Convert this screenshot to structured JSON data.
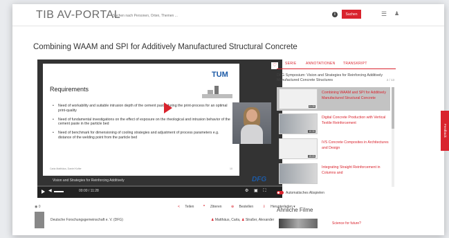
{
  "header": {
    "logo": "TIB AV-PORTAL",
    "search_placeholder": "Suchen nach Personen, Orten, Themen ...",
    "search_button": "Suchen"
  },
  "video": {
    "title": "Combining WAAM and SPI for Additively Manufactured Structural Concrete",
    "slide_title": "Requirements",
    "slide_logo": "TUM",
    "bullets": [
      "Need of workability and suitable intrusion depth of the cement paste during the print-process for an optimal print-quality",
      "Need of fundamental investigations on the effect of exposure on the rheological and intrusion behavior of the cement paste in the particle bed",
      "Need of benchmark for dimensioning of cooling strategies and adjustment of process parameters e.g. distance of the welding point from the particle bed"
    ],
    "slide_footer": "Carla Matthäus, Daniel Kofler",
    "slide_number": "10",
    "caption": "Vision and Strategies for Reinforcing Additively",
    "overlay_logo": "DFG",
    "time": "00:00 / 11:28",
    "progress": 0.0
  },
  "meta": {
    "views": "0",
    "share": "Teilen",
    "cite": "Zitieren",
    "order": "Bestellen",
    "download": "Herunterladen"
  },
  "publisher": {
    "name": "Deutsche Forschungsgemeinschaft e. V. (DFG)",
    "author1": "Matthäus, Carla",
    "author2": "Straßer, Alexander"
  },
  "sidebar": {
    "tabs": [
      "SERIE",
      "ANNOTATIONEN",
      "TRANSKRIPT"
    ],
    "series_title": "DFG Symposium: Vision and Strategies for Reinforcing Additively Manufactured Concrete Structures",
    "series_count": "2 / 13",
    "items": [
      {
        "title": "Combining WAAM and SPI for Additively Manufactured Structural Concrete",
        "duration": "11:28"
      },
      {
        "title": "Digital Concrete Production with Vertical Textile Reinforcement",
        "duration": "10:30"
      },
      {
        "title": "IVS Concrete Composites in Architectures and Design",
        "duration": "15:05"
      },
      {
        "title": "Integrating Straight Reinforcement in Columns and",
        "duration": ""
      }
    ],
    "autoplay_label": "Automatisches Abspielen",
    "similar_title": "Ähnliche Filme",
    "similar_item": "Science for future?"
  },
  "feedback": "Feedback",
  "colors": {
    "accent": "#d9232d",
    "text": "#333333"
  }
}
